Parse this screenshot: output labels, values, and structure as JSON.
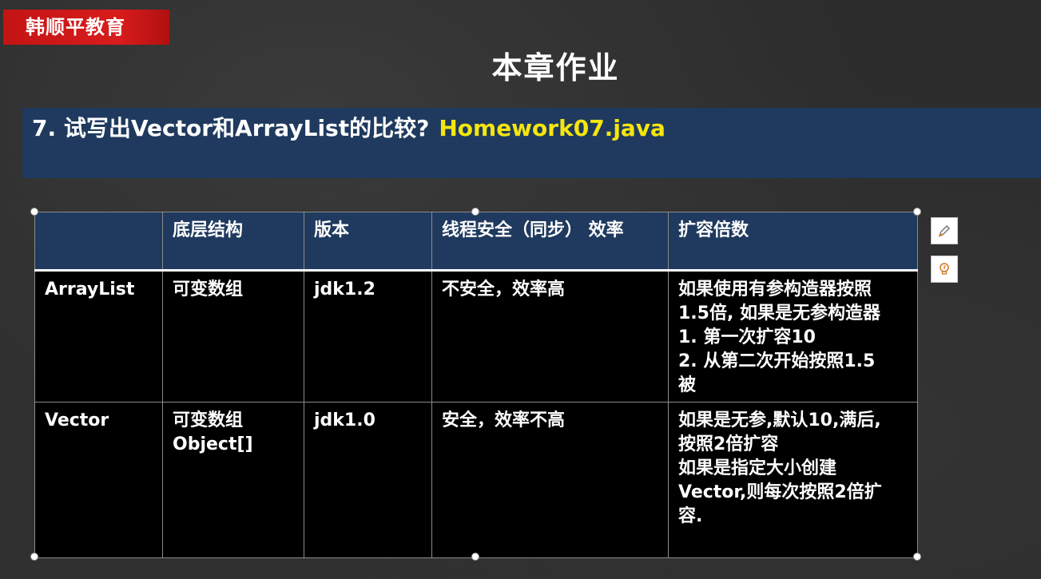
{
  "brand": {
    "label": "韩顺平教育",
    "color": "#d81c1c"
  },
  "page": {
    "title": "本章作业"
  },
  "question": {
    "text": "7. 试写出Vector和ArrayList的比较?",
    "file": "Homework07.java",
    "bar_color": "#1f3a5e",
    "file_color": "#f5e60e"
  },
  "table": {
    "headers": [
      "",
      "底层结构",
      "版本",
      "线程安全（同步） 效率",
      "扩容倍数"
    ],
    "rows": [
      {
        "name": "ArrayList",
        "structure": [
          "可变数组"
        ],
        "version": "jdk1.2",
        "safety": "不安全，效率高",
        "growth": [
          "如果使用有参构造器按照",
          "1.5倍, 如果是无参构造器",
          "1. 第一次扩容10",
          "2. 从第二次开始按照1.5",
          "被"
        ]
      },
      {
        "name": "Vector",
        "structure": [
          "可变数组",
          "Object[]"
        ],
        "version": "jdk1.0",
        "safety": "安全，效率不高",
        "growth": [
          "如果是无参,默认10,满后,",
          "按照2倍扩容",
          "如果是指定大小创建",
          "Vector,则每次按照2倍扩",
          "容."
        ]
      }
    ]
  },
  "tools": [
    {
      "icon": "pen-edit-icon"
    },
    {
      "icon": "lightbulb-icon"
    }
  ]
}
